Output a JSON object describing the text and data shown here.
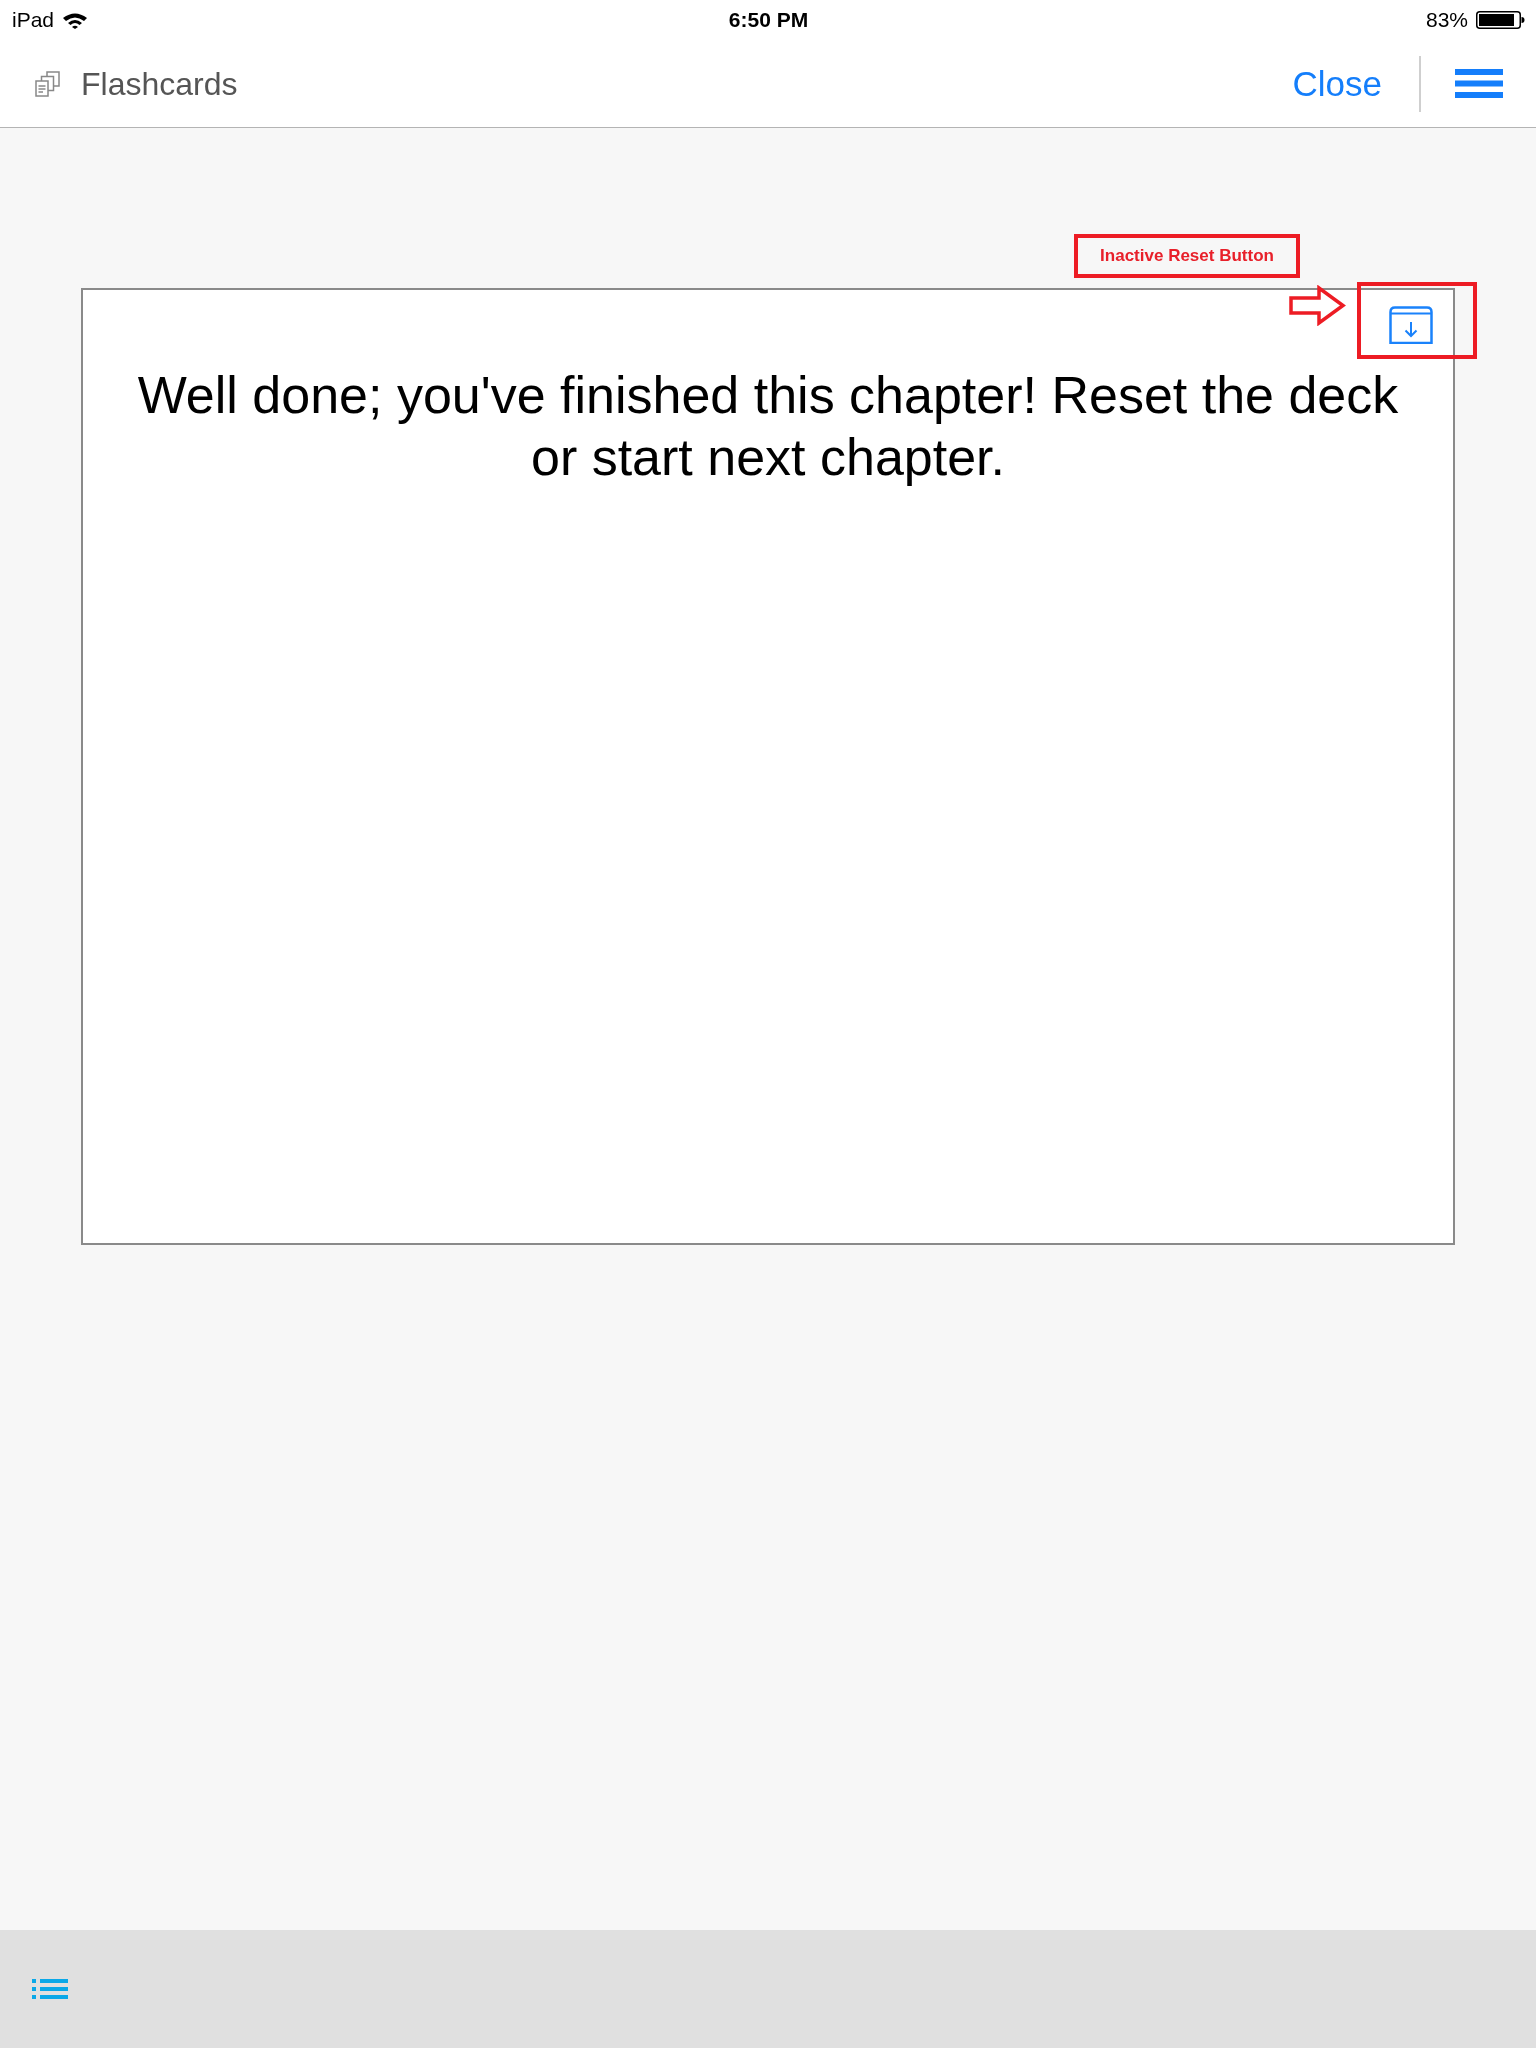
{
  "status_bar": {
    "device": "iPad",
    "time": "6:50 PM",
    "battery": "83%"
  },
  "nav_bar": {
    "title": "Flashcards",
    "close": "Close"
  },
  "card": {
    "message": "Well done; you've finished this chapter! Reset the deck or start next chapter."
  },
  "annotation": {
    "label": "Inactive Reset Button"
  }
}
